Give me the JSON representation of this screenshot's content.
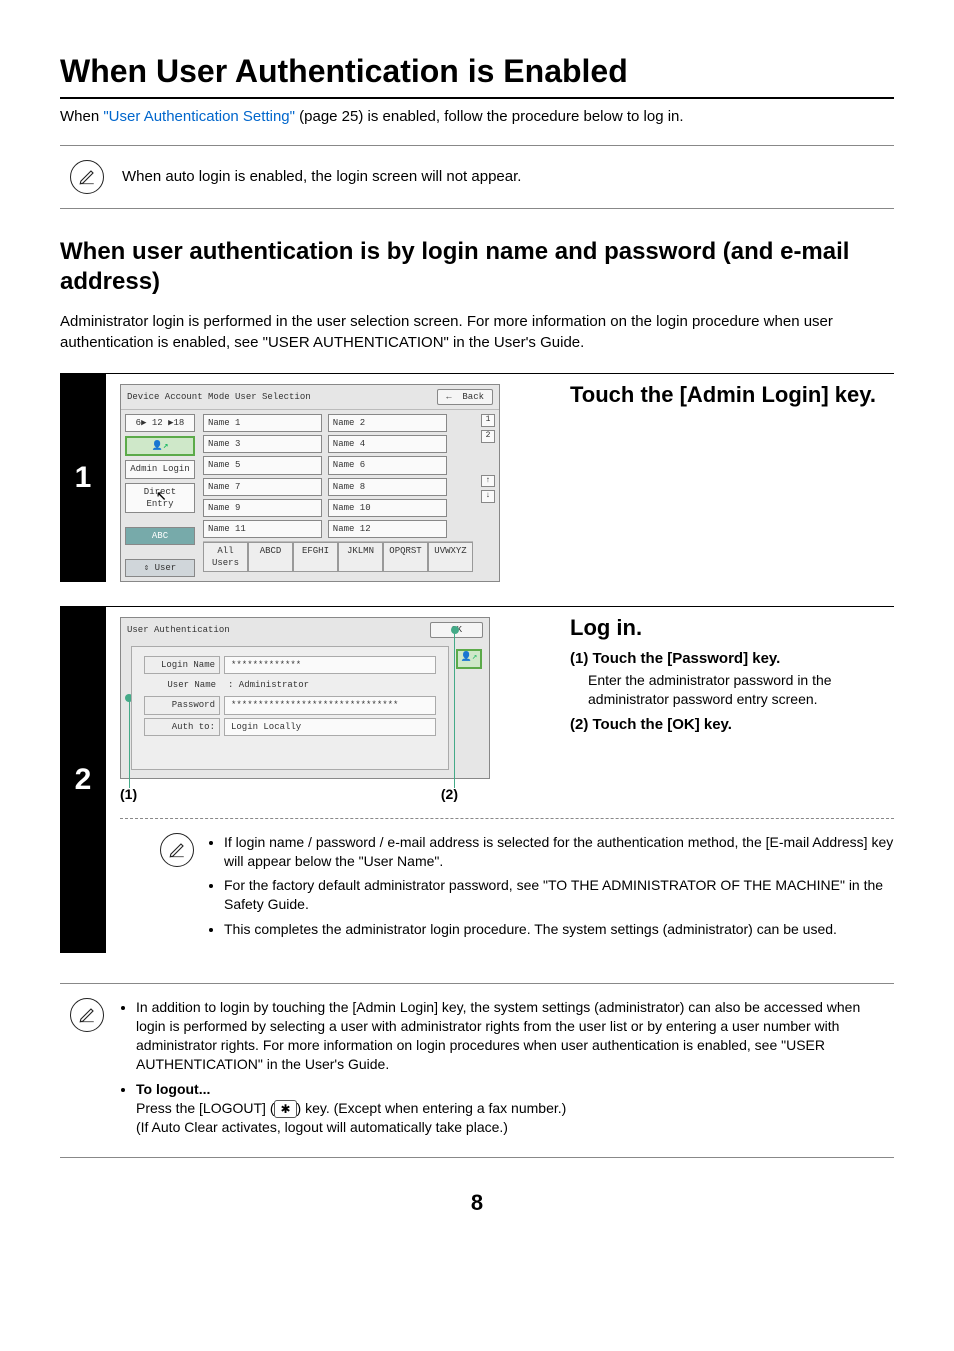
{
  "h1": "When User Authentication is Enabled",
  "intro_pre": "When ",
  "intro_link": "\"User Authentication Setting\"",
  "intro_post": " (page 25) is enabled, follow the procedure below to log in.",
  "autologin_note": "When auto login is enabled, the login screen will not appear.",
  "h2": "When user authentication is by login name and password (and e-mail address)",
  "subdesc": "Administrator login is performed in the user selection screen. For more information on the login procedure when user authentication is enabled, see \"USER AUTHENTICATION\" in the User's Guide.",
  "chart_data": {
    "type": "table",
    "steps": [
      {
        "n": "1",
        "title": "Touch the [Admin Login] key.",
        "screen": {
          "title": "Device Account Mode User Selection",
          "back": "Back",
          "page_indicator": "6▶ 12 ▶18",
          "side": [
            "Admin Login",
            "Direct Entry"
          ],
          "side_footer_top": "ABC",
          "side_footer_bottom": "User",
          "names": [
            "Name 1",
            "Name 2",
            "Name 3",
            "Name 4",
            "Name 5",
            "Name 6",
            "Name 7",
            "Name 8",
            "Name 9",
            "Name 10",
            "Name 11",
            "Name 12"
          ],
          "right": [
            "1",
            "2",
            "↑",
            "↓"
          ],
          "tabs": [
            "All Users",
            "ABCD",
            "EFGHI",
            "JKLMN",
            "OPQRST",
            "UVWXYZ"
          ]
        }
      },
      {
        "n": "2",
        "title": "Log in.",
        "sub": [
          {
            "h": "(1) Touch the [Password] key.",
            "p": "Enter the administrator password in the administrator password entry screen."
          },
          {
            "h": "(2) Touch the [OK] key.",
            "p": ""
          }
        ],
        "screen": {
          "title": "User Authentication",
          "ok": "OK",
          "fields": [
            {
              "label": "Login Name",
              "value": "*************",
              "boxed": true
            },
            {
              "label": "User Name",
              "value": ": Administrator",
              "boxed": false
            },
            {
              "label": "Password",
              "value": "*******************************",
              "boxed": true
            },
            {
              "label": "Auth to:",
              "value": "Login Locally",
              "boxed": true
            }
          ],
          "call_labels": {
            "left": "(1)",
            "right": "(2)"
          }
        },
        "notes": [
          "If login name / password / e-mail address is selected for the authentication method, the [E-mail Address] key will appear below the \"User Name\".",
          "For the factory default administrator password, see \"TO THE ADMINISTRATOR OF THE MACHINE\" in the Safety Guide.",
          "This completes the administrator login procedure. The system settings (administrator) can be used."
        ]
      }
    ]
  },
  "final": {
    "bullets": [
      "In addition to login by touching the [Admin Login] key, the system settings (administrator) can also be accessed when login is performed by selecting a user with administrator rights from the user list or by entering a user number with administrator rights. For more information on login procedures when user authentication is enabled, see \"USER AUTHENTICATION\" in the User's Guide."
    ],
    "logout_h": "To logout...",
    "logout_p1_pre": "Press the [LOGOUT] (",
    "logout_key": "✱",
    "logout_p1_post": ") key. (Except when entering a fax number.)",
    "logout_p2": "(If Auto Clear activates, logout will automatically take place.)"
  },
  "page_number": "8"
}
